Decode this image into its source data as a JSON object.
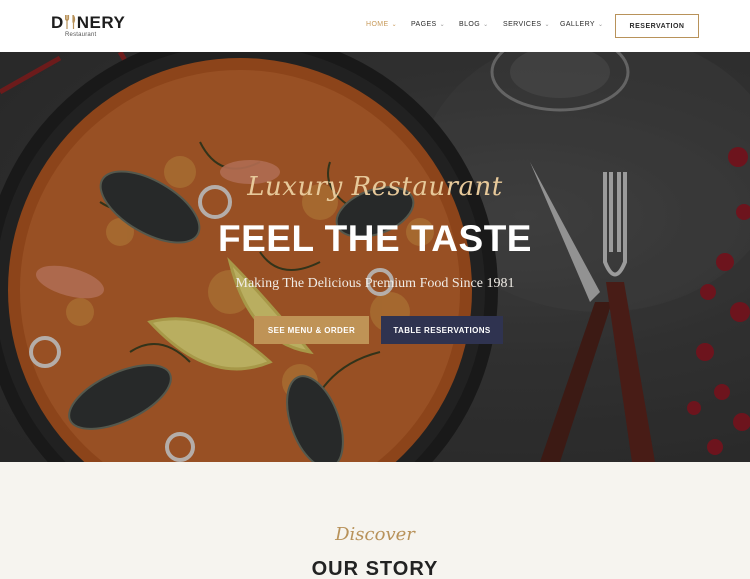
{
  "brand": {
    "name_left": "D",
    "name_right": "NERY",
    "tagline": "Restaurant"
  },
  "nav": {
    "items": [
      {
        "label": "HOME",
        "active": true
      },
      {
        "label": "PAGES",
        "active": false
      },
      {
        "label": "BLOG",
        "active": false
      },
      {
        "label": "SERVICES",
        "active": false
      },
      {
        "label": "GALLERY",
        "active": false
      }
    ],
    "reservation_label": "RESERVATION"
  },
  "hero": {
    "script": "Luxury Restaurant",
    "title": "FEEL THE TASTE",
    "subtitle": "Making The Delicious Premium Food Since 1981",
    "primary_button": "SEE MENU & ORDER",
    "secondary_button": "TABLE RESERVATIONS"
  },
  "story": {
    "script": "Discover",
    "title": "OUR STORY"
  },
  "colors": {
    "accent": "#bf9356",
    "navy": "#2f3350",
    "active_nav": "#c79a5a"
  }
}
